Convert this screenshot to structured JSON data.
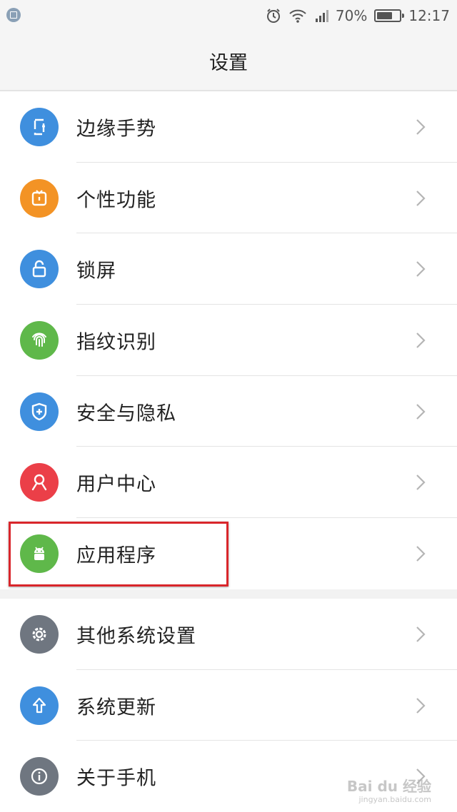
{
  "status_bar": {
    "battery_text": "70%",
    "battery_level": 0.7,
    "time": "12:17"
  },
  "header": {
    "title": "设置"
  },
  "colors": {
    "blue": "#3f8fde",
    "orange": "#f39325",
    "green": "#5fb84a",
    "red": "#eb3f48",
    "gray": "#6f7680",
    "highlight": "#d9262b"
  },
  "group1": [
    {
      "label": "边缘手势",
      "icon": "edge-gesture-icon",
      "color": "#3f8fde"
    },
    {
      "label": "个性功能",
      "icon": "personality-icon",
      "color": "#f39325"
    },
    {
      "label": "锁屏",
      "icon": "lock-icon",
      "color": "#3f8fde"
    },
    {
      "label": "指纹识别",
      "icon": "fingerprint-icon",
      "color": "#5fb84a"
    },
    {
      "label": "安全与隐私",
      "icon": "shield-icon",
      "color": "#3f8fde"
    },
    {
      "label": "用户中心",
      "icon": "user-icon",
      "color": "#eb3f48"
    },
    {
      "label": "应用程序",
      "icon": "android-icon",
      "color": "#5fb84a"
    }
  ],
  "group2": [
    {
      "label": "其他系统设置",
      "icon": "gear-icon",
      "color": "#6f7680"
    },
    {
      "label": "系统更新",
      "icon": "upload-arrow-icon",
      "color": "#3f8fde"
    },
    {
      "label": "关于手机",
      "icon": "info-icon",
      "color": "#6f7680"
    }
  ],
  "watermark": {
    "brand": "Bai du 经验",
    "url": "jingyan.baidu.com"
  }
}
